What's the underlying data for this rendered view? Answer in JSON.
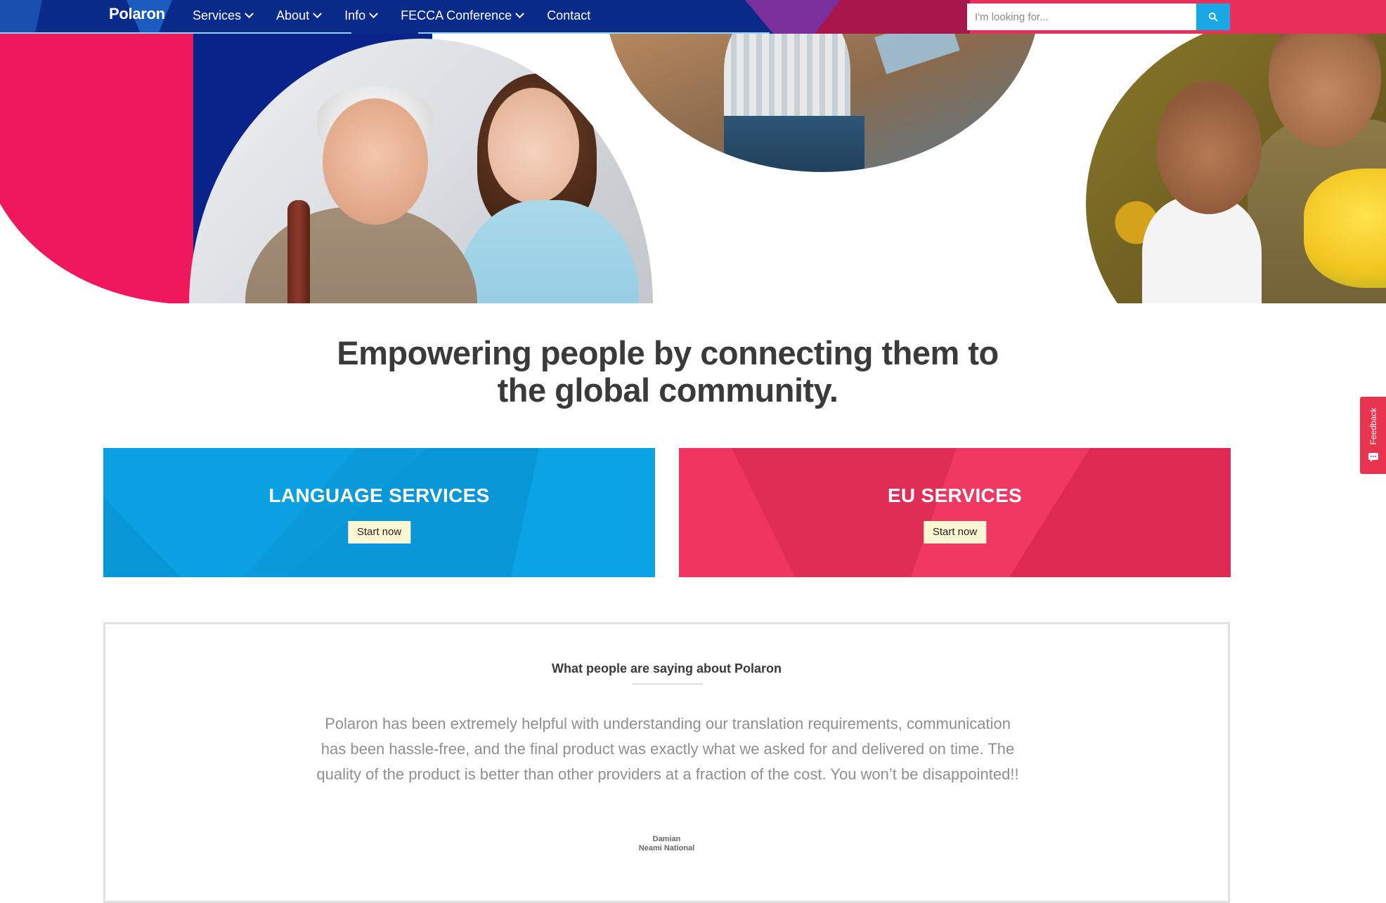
{
  "nav": {
    "brand": "Polaron",
    "items": [
      {
        "label": "Services",
        "has_dropdown": true
      },
      {
        "label": "About",
        "has_dropdown": true
      },
      {
        "label": "Info",
        "has_dropdown": true
      },
      {
        "label": "FECCA Conference",
        "has_dropdown": true
      },
      {
        "label": "Contact",
        "has_dropdown": false
      }
    ],
    "search": {
      "placeholder": "I'm looking for...",
      "value": "",
      "icon": "search-icon"
    }
  },
  "hero": {
    "images": [
      "photo-elderly-man-and-young-woman",
      "photo-people-at-work-table",
      "photo-mother-and-daughter-at-market"
    ]
  },
  "headline": {
    "line1": "Empowering people by connecting them to",
    "line2": "the global community."
  },
  "services": [
    {
      "title": "LANGUAGE SERVICES",
      "button": "Start now",
      "color": "#0aa0e2"
    },
    {
      "title": "EU SERVICES",
      "button": "Start now",
      "color": "#f0365f"
    }
  ],
  "testimonial": {
    "heading": "What people are saying about Polaron",
    "quote": "Polaron has been extremely helpful with understanding our translation requirements, communication has been hassle-free, and the final product was exactly what we asked for and delivered on time. The quality of the product is better than other providers at a fraction of the cost. You won’t be disappointed!!",
    "author_name": "Damian",
    "author_org": "Neami National"
  },
  "feedback": {
    "label": "Feedback",
    "icon": "chat-icon",
    "color": "#e8344f"
  },
  "colors": {
    "navy": "#0a2a8a",
    "blue": "#0aa0e2",
    "pink": "#f0365f",
    "magenta": "#e8175d"
  }
}
